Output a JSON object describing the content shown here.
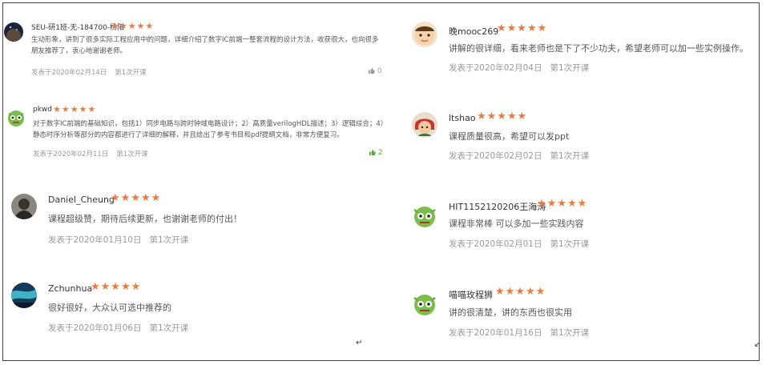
{
  "reviews": [
    {
      "username": "SEU-研1班-无-184700-杨阳",
      "stars": "★★★★★",
      "content": "生动形象，讲到了很多实际工程应用中的问题，详细介绍了数字IC前端一整套流程的设计方法，收获很大，也向很多朋友推荐了，衷心地谢谢老师。",
      "date": "发表于2020年02月14日",
      "session": "第1次开课",
      "likes": "0",
      "avatar_icon": "night-sky-avatar-icon"
    },
    {
      "username": "pkwd",
      "stars": "★★★★★",
      "content": "对于数字IC前端的基础知识，包括1）同步电路与跨时钟域电路设计；2）高质量verilogHDL描述；3）逻辑综合；4）静态时序分析等部分的内容都进行了详细的解释，并且给出了参考书目和pdf提纲文档，非常方便复习。",
      "date": "发表于2020年02月11日",
      "session": "第1次开课",
      "likes": "2",
      "avatar_icon": "green-monster-avatar-icon"
    },
    {
      "username": "Daniel_Cheung",
      "stars": "★★★★★",
      "content": "课程超级赞，期待后续更新，也谢谢老师的付出！",
      "date": "发表于2020年01月10日",
      "session": "第1次开课",
      "avatar_icon": "person-photo-avatar-icon"
    },
    {
      "username": "Zchunhua",
      "stars": "★★★★★",
      "content": "很好很好，大众认可选中推荐的",
      "date": "发表于2020年01月06日",
      "session": "第1次开课",
      "avatar_icon": "aurora-avatar-icon"
    },
    {
      "username": "晚mooc269",
      "stars": "★★★★★",
      "content": "讲解的很详细，看来老师也是下了不少功夫，希望老师可以加一些实例操作。",
      "date": "发表于2020年02月04日",
      "session": "第1次开课",
      "avatar_icon": "baby-face-avatar-icon"
    },
    {
      "username": "ltshao",
      "stars": "★★★★★",
      "content": "课程质量很高，希望可以发ppt",
      "date": "发表于2020年02月02日",
      "session": "第1次开课",
      "avatar_icon": "cartoon-girl-avatar-icon"
    },
    {
      "username": "HIT1152120206王海涛",
      "stars": "★★★★★",
      "content": "课程非常棒 可以多加一些实践内容",
      "date": "发表于2020年02月01日",
      "session": "第1次开课",
      "avatar_icon": "green-monster-avatar-icon"
    },
    {
      "username": "喵喵玫程狮",
      "stars": "★★★★★",
      "content": "讲的很清楚，讲的东西也很实用",
      "date": "发表于2020年01月16日",
      "session": "第1次开课",
      "avatar_icon": "green-monster-avatar-icon"
    }
  ],
  "misc": {
    "cursor_mark": "↵",
    "edge_mark": "↙"
  },
  "colors": {
    "star": "#ed7a3b",
    "like_active": "#5aa83b",
    "meta": "#999999"
  }
}
